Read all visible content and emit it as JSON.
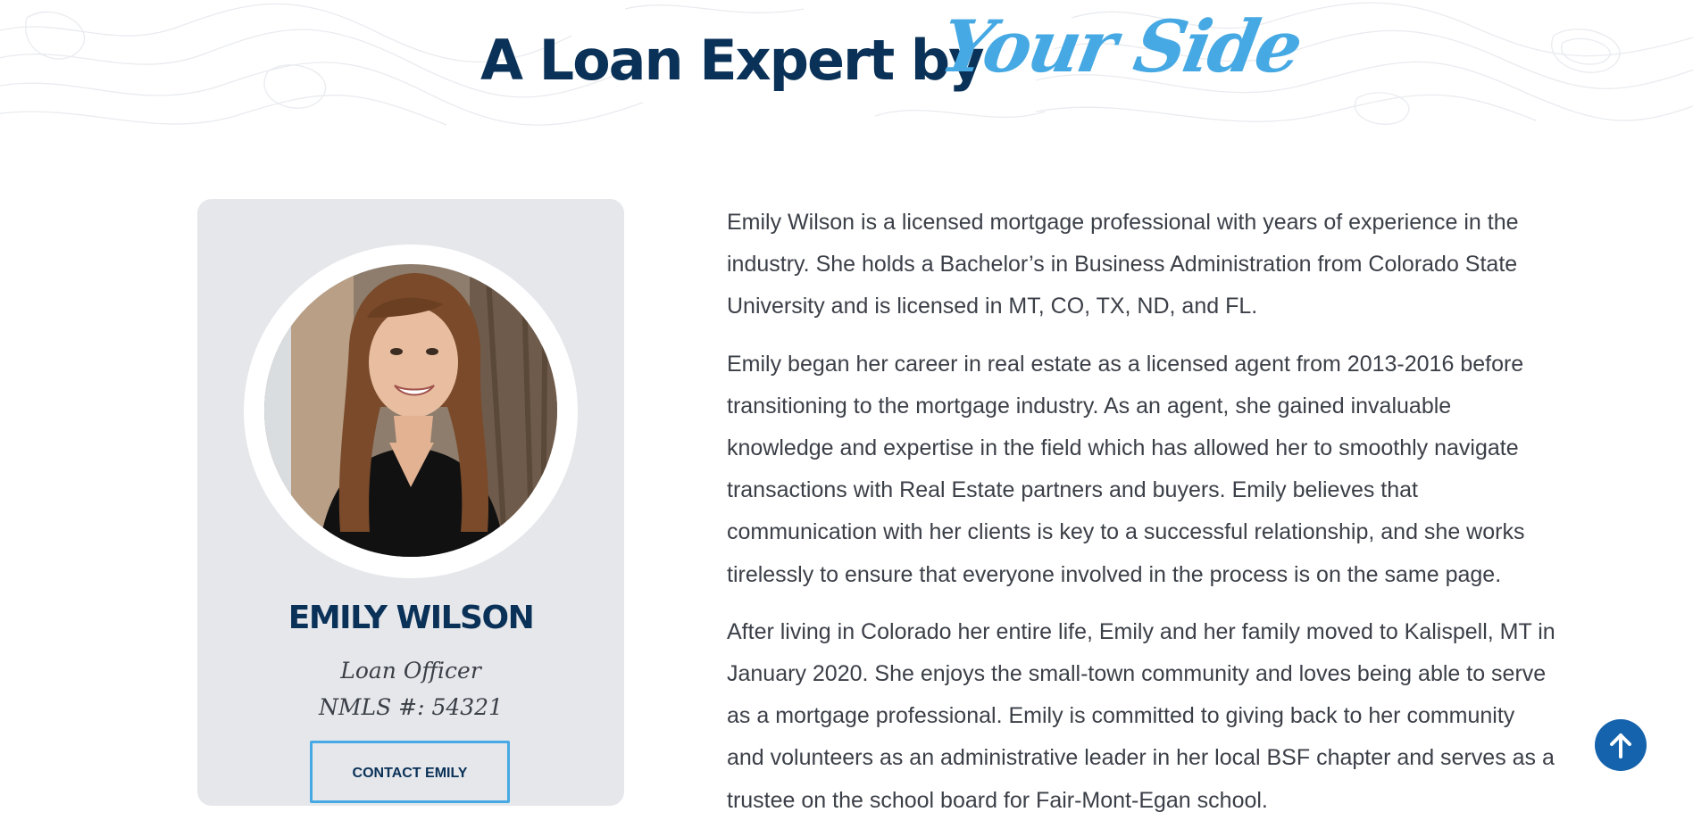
{
  "hero": {
    "title_main": "A Loan Expert by",
    "title_script": "Your Side"
  },
  "profile": {
    "name": "EMILY WILSON",
    "role": "Loan Officer",
    "nmls": "NMLS #: 54321",
    "contact_label": "CONTACT EMILY",
    "photo_icon": "portrait-photo"
  },
  "bio": {
    "paragraphs": [
      "Emily Wilson is a licensed mortgage professional with years of experience in the industry. She holds a Bachelor’s in Business Administration from Colorado State University and is licensed in MT, CO, TX, ND, and FL.",
      "Emily began her career in real estate as a licensed agent from 2013-2016 before transitioning to the mortgage industry. As an agent, she gained invaluable knowledge and expertise in the field which has allowed her to smoothly navigate transactions with Real Estate partners and buyers. Emily believes that communication with her clients is key to a successful relationship, and she works tirelessly to ensure that everyone involved in the process is on the same page.",
      "After living in Colorado her entire life, Emily and her family moved to Kalispell, MT in January 2020. She enjoys the small-town community and loves being able to serve as a mortgage professional. Emily is committed to giving back to her community and volunteers as an administrative leader in her local BSF chapter and serves as a trustee on the school board for Fair-Mont-Egan school."
    ]
  },
  "scroll_top": {
    "icon": "arrow-up-icon"
  },
  "colors": {
    "navy": "#0a3157",
    "accent_blue": "#46a9e3",
    "card_gray": "#e5e7eb",
    "body_text": "#3b3f47",
    "scroll_button": "#1563ac"
  }
}
